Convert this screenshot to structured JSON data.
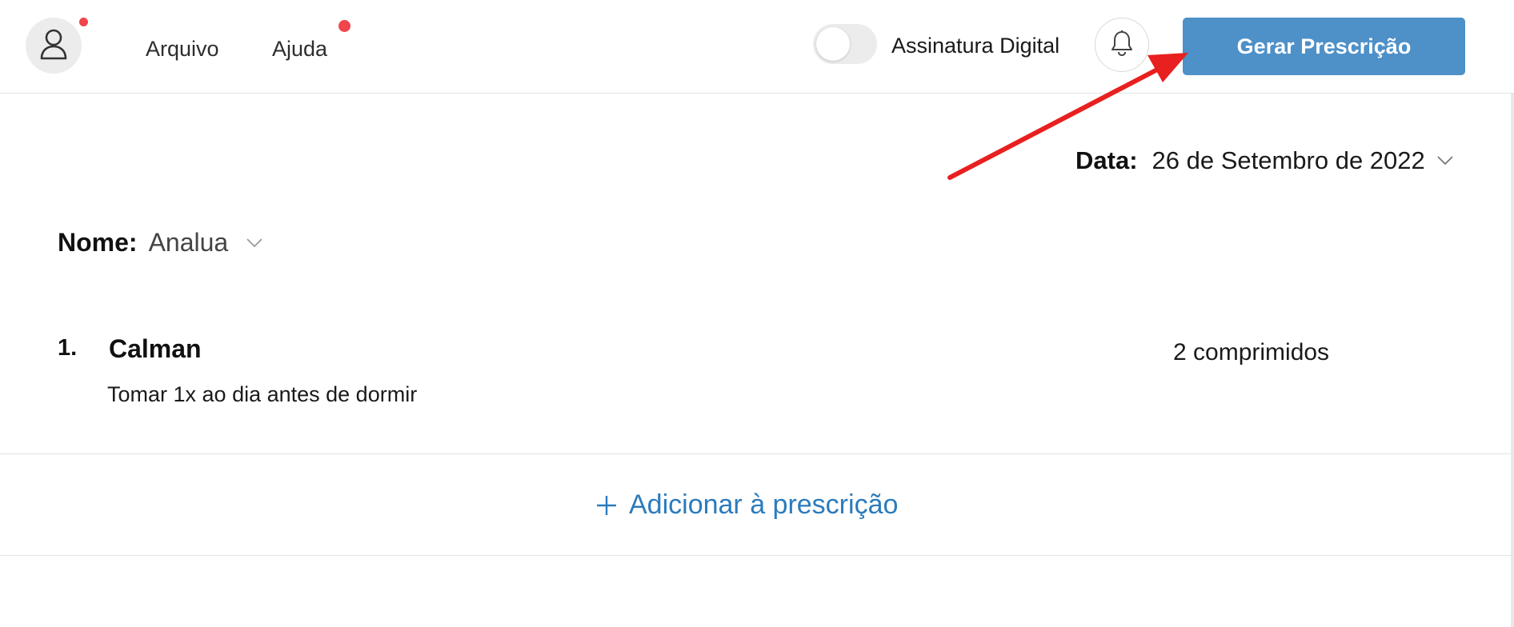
{
  "header": {
    "avatar_icon": "user-icon",
    "menu": [
      "Arquivo",
      "Ajuda"
    ],
    "signature_toggle": {
      "label": "Assinatura Digital",
      "on": false
    },
    "notification_icon": "bell-icon",
    "generate_button": "Gerar Prescrição"
  },
  "prescription": {
    "date_label": "Data:",
    "date_value": "26 de Setembro de 2022",
    "name_label": "Nome:",
    "name_value": "Analua",
    "items": [
      {
        "number": "1.",
        "name": "Calman",
        "instructions": "Tomar 1x ao dia antes de dormir",
        "quantity": "2 comprimidos"
      }
    ],
    "add_label": "Adicionar à prescrição"
  },
  "colors": {
    "primary_button": "#4e90c8",
    "link_blue": "#2b7bbd",
    "notification_dot": "#f0464b",
    "annotation_arrow": "#e8201f"
  }
}
